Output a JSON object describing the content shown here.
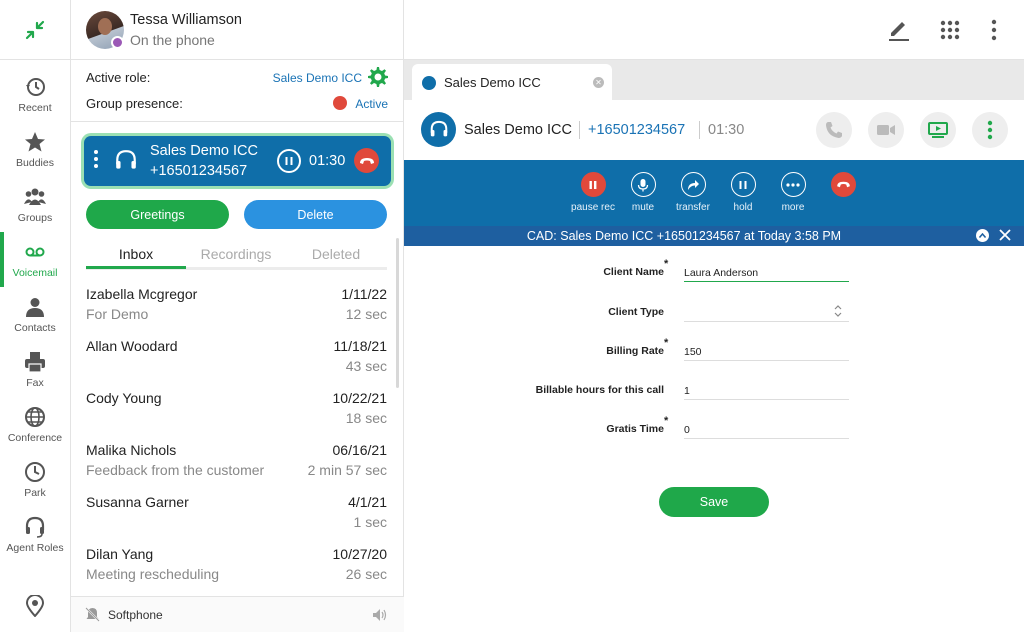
{
  "nav": {
    "items": [
      {
        "label": "Recent",
        "icon": "history-icon"
      },
      {
        "label": "Buddies",
        "icon": "star-icon"
      },
      {
        "label": "Groups",
        "icon": "groups-icon"
      },
      {
        "label": "Voicemail",
        "icon": "voicemail-icon"
      },
      {
        "label": "Contacts",
        "icon": "contact-icon"
      },
      {
        "label": "Fax",
        "icon": "fax-icon"
      },
      {
        "label": "Conference",
        "icon": "globe-icon"
      },
      {
        "label": "Park",
        "icon": "clock-icon"
      },
      {
        "label": "Agent Roles",
        "icon": "headset-icon"
      }
    ],
    "active": "Voicemail",
    "accent": "#21a84c"
  },
  "user": {
    "name": "Tessa Williamson",
    "status": "On the phone"
  },
  "role": {
    "active_role_label": "Active role:",
    "active_role_value": "Sales Demo ICC",
    "presence_label": "Group presence:",
    "presence_value": "Active"
  },
  "active_call": {
    "name": "Sales Demo ICC",
    "number": "+16501234567",
    "duration": "01:30"
  },
  "voicemail": {
    "greetings_label": "Greetings",
    "delete_label": "Delete",
    "tabs": [
      "Inbox",
      "Recordings",
      "Deleted"
    ],
    "active_tab": "Inbox",
    "messages": [
      {
        "name": "Izabella Mcgregor",
        "date": "1/11/22",
        "note": "For Demo",
        "duration": "12 sec"
      },
      {
        "name": "Allan Woodard",
        "date": "11/18/21",
        "note": "",
        "duration": "43 sec"
      },
      {
        "name": "Cody Young",
        "date": "10/22/21",
        "note": "",
        "duration": "18 sec"
      },
      {
        "name": "Malika Nichols",
        "date": "06/16/21",
        "note": "Feedback from the customer",
        "duration": "2 min 57 sec"
      },
      {
        "name": "Susanna Garner",
        "date": "4/1/21",
        "note": "",
        "duration": "1 sec"
      },
      {
        "name": "Dilan Yang",
        "date": "10/27/20",
        "note": "Meeting rescheduling",
        "duration": "26 sec"
      }
    ]
  },
  "softphone": {
    "label": "Softphone"
  },
  "session_tab": {
    "label": "Sales Demo ICC"
  },
  "call_header": {
    "name": "Sales Demo ICC",
    "number": "+16501234567",
    "duration": "01:30"
  },
  "controls": [
    {
      "label": "pause rec",
      "icon": "pause-rec-icon"
    },
    {
      "label": "mute",
      "icon": "mic-icon"
    },
    {
      "label": "transfer",
      "icon": "transfer-icon"
    },
    {
      "label": "hold",
      "icon": "hold-icon"
    },
    {
      "label": "more",
      "icon": "more-icon"
    }
  ],
  "cad": {
    "title": "CAD: Sales Demo ICC +16501234567 at Today 3:58 PM",
    "fields": [
      {
        "label": "Client Name",
        "required": "*",
        "value": "Laura Anderson"
      },
      {
        "label": "Client Type",
        "required": "",
        "value": ""
      },
      {
        "label": "Billing Rate",
        "required": "*",
        "value": "150"
      },
      {
        "label": "Billable hours for this call",
        "required": "",
        "value": "1"
      },
      {
        "label": "Gratis Time",
        "required": "*",
        "value": "0"
      }
    ],
    "save_label": "Save"
  },
  "colors": {
    "green": "#1fa84a",
    "blue": "#0f6ea9",
    "red": "#e0493b",
    "link": "#1a73b5"
  }
}
